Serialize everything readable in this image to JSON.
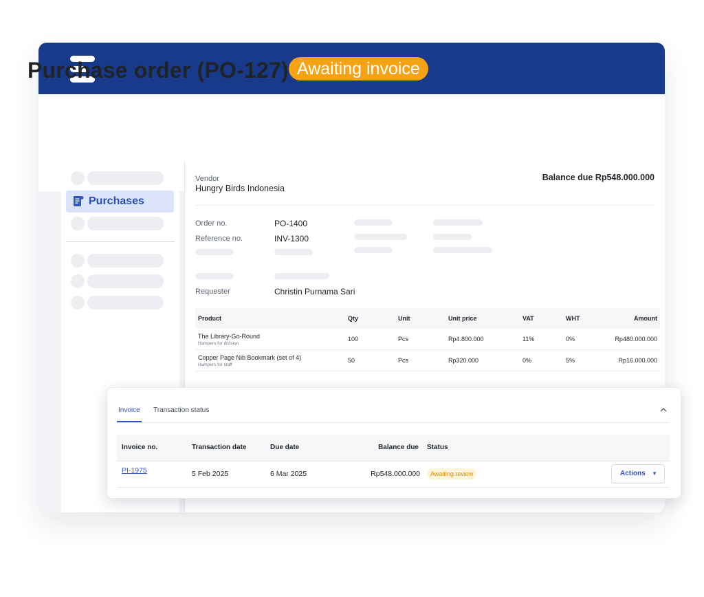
{
  "header": {
    "title": "Purchase order (PO-127)",
    "status": "Awaiting invoice"
  },
  "sidebar": {
    "active_item": "Purchases"
  },
  "po": {
    "vendor_label": "Vendor",
    "vendor_name": "Hungry Birds Indonesia",
    "balance_due": "Balance due Rp548.000.000",
    "order_no_label": "Order no.",
    "order_no": "PO-1400",
    "reference_no_label": "Reference no.",
    "reference_no": "INV-1300",
    "requester_label": "Requester",
    "requester": "Christin Purnama Sari"
  },
  "items_table": {
    "columns": [
      "Product",
      "Qty",
      "Unit",
      "Unit price",
      "VAT",
      "WHT",
      "Amount"
    ],
    "rows": [
      {
        "product": "The Library-Go-Round",
        "note": "Hampers for division",
        "qty": "100",
        "unit": "Pcs",
        "unit_price": "Rp4.800.000",
        "vat": "11%",
        "wht": "0%",
        "amount": "Rp480.000.000"
      },
      {
        "product": "Copper Page Nib Bookmark (set of 4)",
        "note": "Hampers for staff",
        "qty": "50",
        "unit": "Pcs",
        "unit_price": "Rp320.000",
        "vat": "0%",
        "wht": "5%",
        "amount": "Rp16.000.000"
      }
    ]
  },
  "invoice_panel": {
    "tabs": [
      "Invoice",
      "Transaction status"
    ],
    "columns": [
      "Invoice no.",
      "Transaction date",
      "Due date",
      "Balance due",
      "Status"
    ],
    "row": {
      "invoice_no": "PI-1975",
      "transaction_date": "5 Feb 2025",
      "due_date": "6 Mar 2025",
      "balance_due": "Rp548.000.000",
      "status": "Awaiting review",
      "actions_label": "Actions"
    }
  },
  "colors": {
    "header_bg": "#193a8a",
    "status_pill": "#f5a314",
    "accent": "#3255c4",
    "badge_bg": "#fff4d6",
    "badge_text": "#d98e04"
  },
  "icons": [
    "menu-logo-icon",
    "receipt-icon",
    "chevron-up-icon",
    "caret-down-icon"
  ]
}
